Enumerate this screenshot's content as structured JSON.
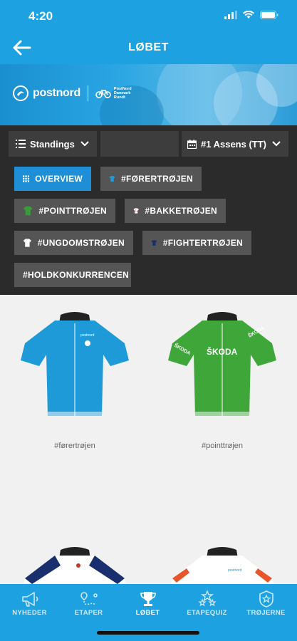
{
  "status": {
    "time": "4:20"
  },
  "header": {
    "title": "LØBET"
  },
  "banner": {
    "brand": "postnord",
    "sub_line1": "PostNord",
    "sub_line2": "Danmark",
    "sub_line3": "Rundt"
  },
  "filters": {
    "standings_label": "Standings",
    "stage_label": "#1 Assens (TT)",
    "chips": [
      {
        "label": "OVERVIEW",
        "icon": "grid-icon",
        "active": true
      },
      {
        "label": "#FØRERTRØJEN",
        "icon": "jersey-icon",
        "color": "#1e9ad8"
      },
      {
        "label": "#POINTTRØJEN",
        "icon": "jersey-icon",
        "color": "#3b9a3b"
      },
      {
        "label": "#BAKKETRØJEN",
        "icon": "jersey-icon",
        "color": "#ffffff"
      },
      {
        "label": "#UNGDOMSTRØJEN",
        "icon": "jersey-icon",
        "color": "#ffffff"
      },
      {
        "label": "#FIGHTERTRØJEN",
        "icon": "jersey-icon",
        "color": "#1a2f6e"
      },
      {
        "label": "#HOLDKONKURRENCEN",
        "icon": "",
        "active": false
      }
    ]
  },
  "jerseys": [
    {
      "label": "#førertrøjen",
      "color": "#1e9ad8"
    },
    {
      "label": "#pointtrøjen",
      "color": "#3fa63a"
    }
  ],
  "tabs": [
    {
      "label": "NYHEDER",
      "icon": "megaphone-icon"
    },
    {
      "label": "ETAPER",
      "icon": "route-icon"
    },
    {
      "label": "LØBET",
      "icon": "trophy-icon",
      "active": true
    },
    {
      "label": "ETAPEQUIZ",
      "icon": "stars-icon"
    },
    {
      "label": "TRØJERNE",
      "icon": "badge-star-icon"
    }
  ],
  "colors": {
    "primary": "#1da1e1",
    "dark_panel": "#2b2b2b",
    "chip": "#555555",
    "chip_active": "#1e8fd6"
  }
}
